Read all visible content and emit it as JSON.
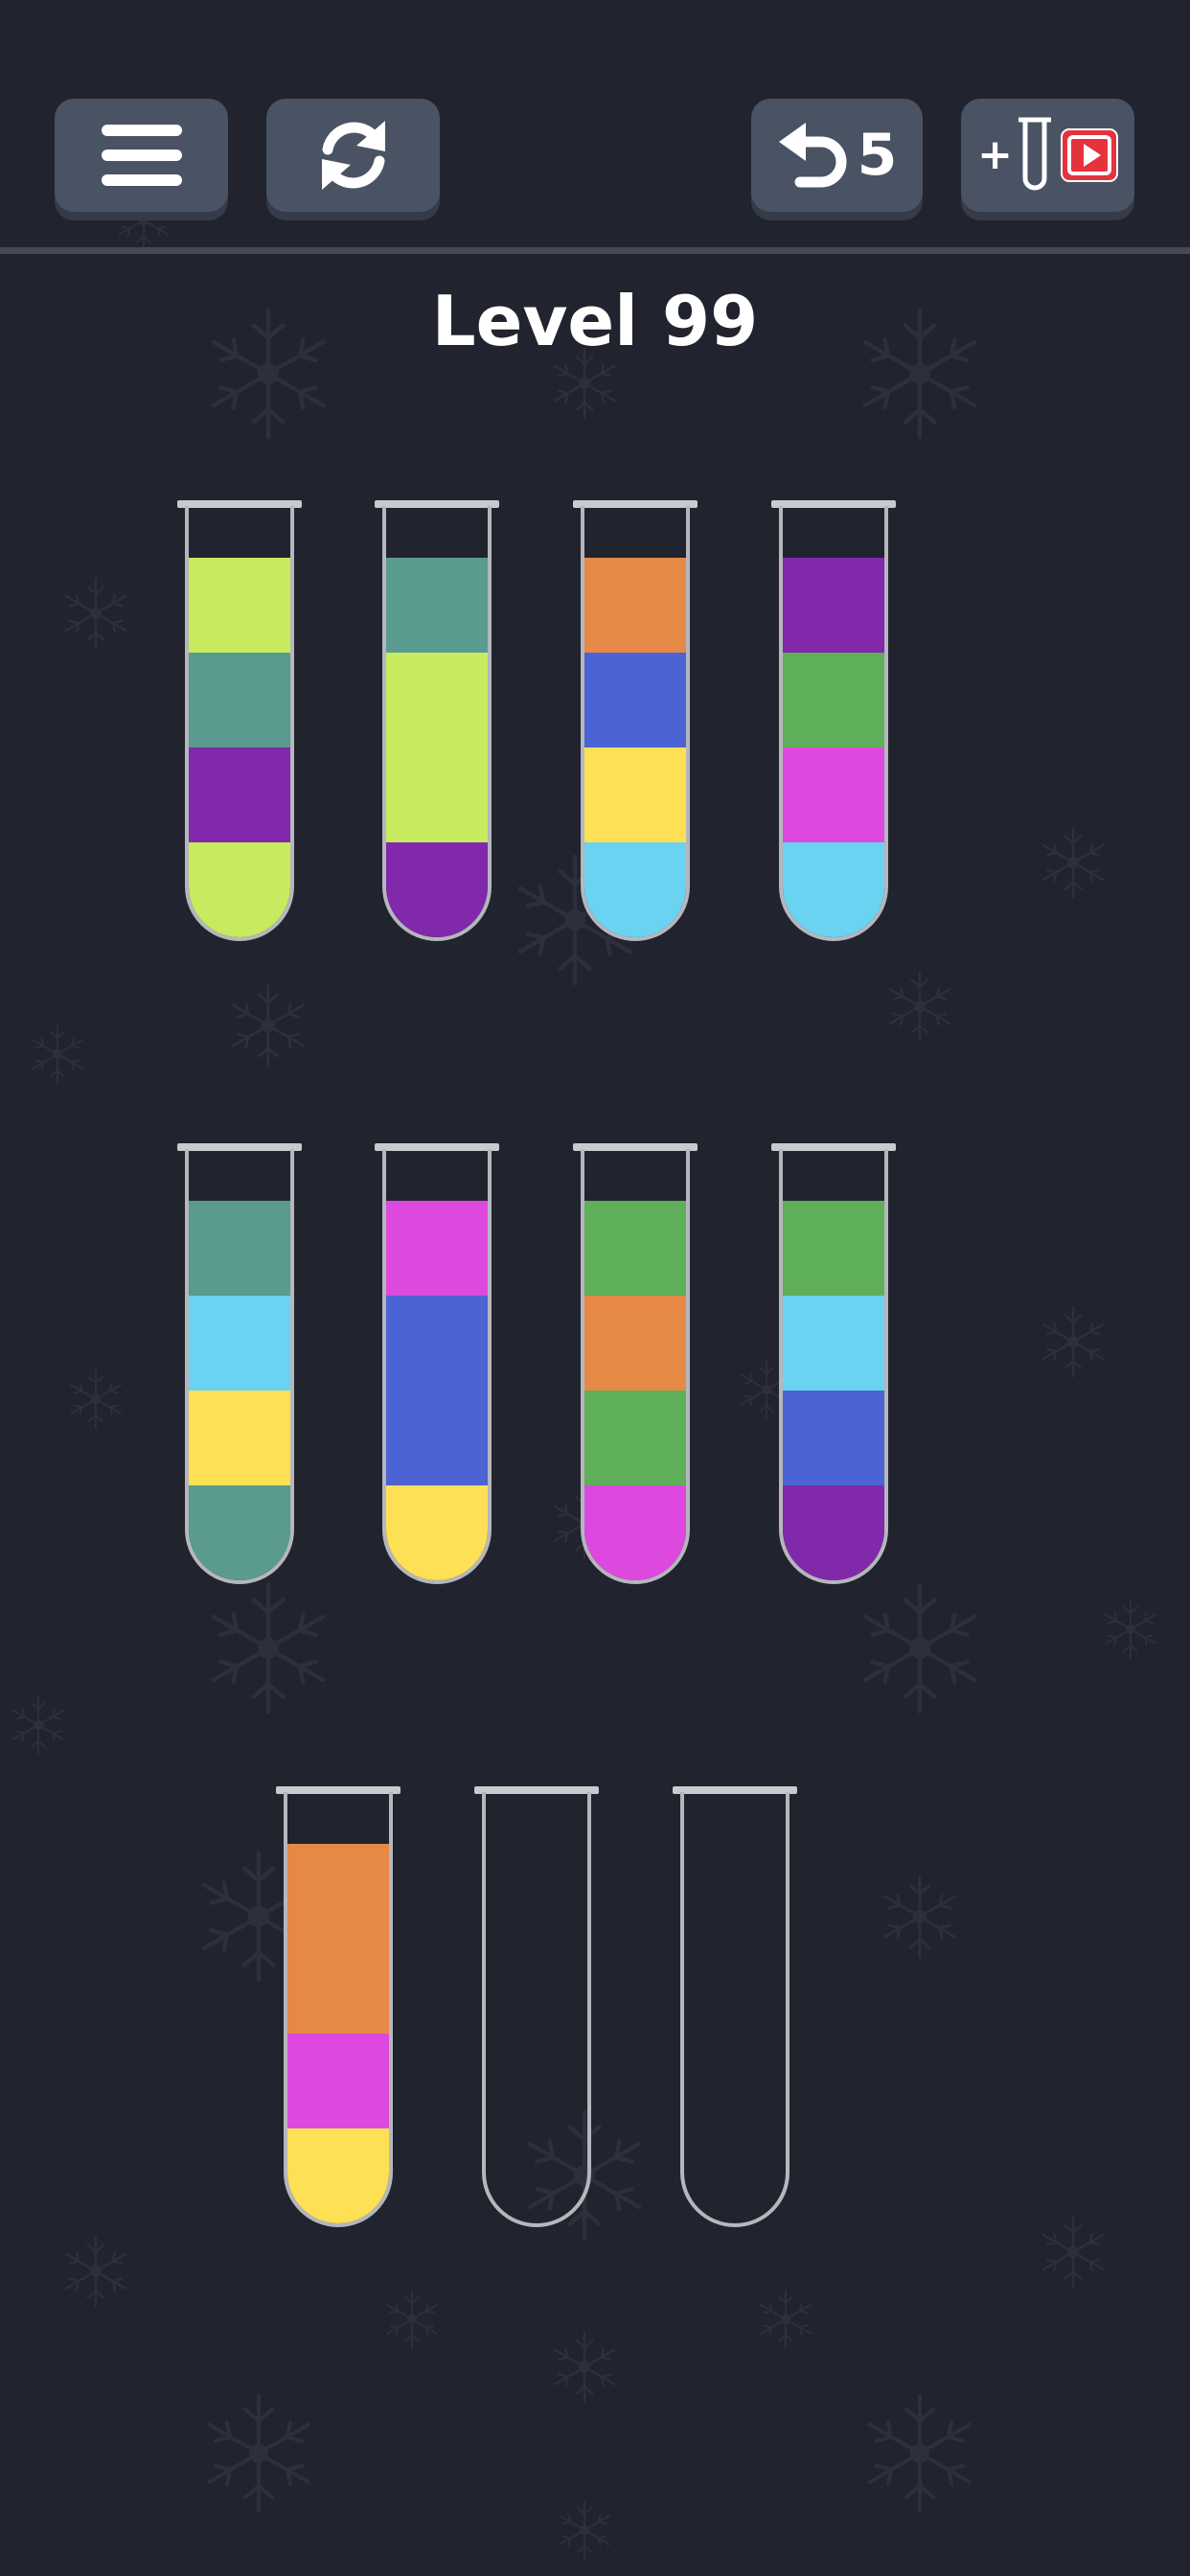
{
  "toolbar": {
    "menu_icon": "hamburger-menu-icon",
    "restart_icon": "restart-arrows-icon",
    "undo_icon": "undo-arrow-icon",
    "undo_count": "5",
    "add_tube_plus": "+",
    "add_tube_icon": "test-tube-icon",
    "video_icon": "video-play-icon"
  },
  "level": {
    "title": "Level 99"
  },
  "theme": {
    "background": "#21232e",
    "button": "#4a5364",
    "button_shadow": "#353b48",
    "divider": "#444857",
    "video_badge": "#e5333d"
  },
  "palette": {
    "lime": "#c7ea5f",
    "teal": "#5a9a8f",
    "purple": "#8228ab",
    "orange": "#e68946",
    "blue": "#4b63d3",
    "yellow": "#fee055",
    "sky": "#6ad3f1",
    "green": "#5fae5a",
    "magenta": "#dd49de"
  },
  "tubes": [
    {
      "layers": [
        "lime",
        "purple",
        "teal",
        "lime"
      ]
    },
    {
      "layers": [
        "purple",
        "lime",
        "lime",
        "teal"
      ]
    },
    {
      "layers": [
        "sky",
        "yellow",
        "blue",
        "orange"
      ]
    },
    {
      "layers": [
        "sky",
        "magenta",
        "green",
        "purple"
      ]
    },
    {
      "layers": [
        "teal",
        "yellow",
        "sky",
        "teal"
      ]
    },
    {
      "layers": [
        "yellow",
        "blue",
        "blue",
        "magenta"
      ]
    },
    {
      "layers": [
        "magenta",
        "green",
        "orange",
        "green"
      ]
    },
    {
      "layers": [
        "purple",
        "blue",
        "sky",
        "green"
      ]
    },
    {
      "layers": [
        "yellow",
        "magenta",
        "orange",
        "orange"
      ]
    },
    {
      "layers": []
    },
    {
      "layers": []
    }
  ]
}
